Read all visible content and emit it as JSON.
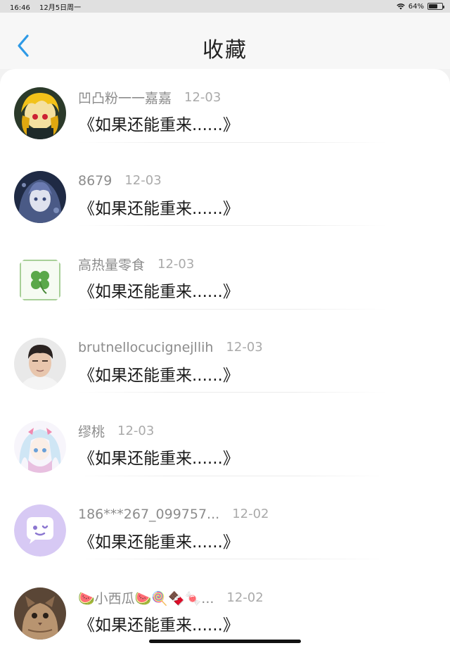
{
  "status": {
    "time": "16:46",
    "date": "12月5日周一",
    "battery": "64%",
    "battery_level": 0.64
  },
  "header": {
    "title": "收藏"
  },
  "items": [
    {
      "name": "凹凸粉一一嘉嘉",
      "date": "12-03",
      "message": "《如果还能重来......》"
    },
    {
      "name": "8679",
      "date": "12-03",
      "message": "《如果还能重来......》"
    },
    {
      "name": "高热量零食",
      "date": "12-03",
      "message": "《如果还能重来......》"
    },
    {
      "name": "brutnellocucignejllih",
      "date": "12-03",
      "message": "《如果还能重来......》"
    },
    {
      "name": "缪桃",
      "date": "12-03",
      "message": "《如果还能重来......》"
    },
    {
      "name": "186***267_099757...",
      "date": "12-02",
      "message": "《如果还能重来......》"
    },
    {
      "name": "🍉小西瓜🍉🍭🍫🍬...",
      "date": "12-02",
      "message": "《如果还能重来......》"
    }
  ]
}
